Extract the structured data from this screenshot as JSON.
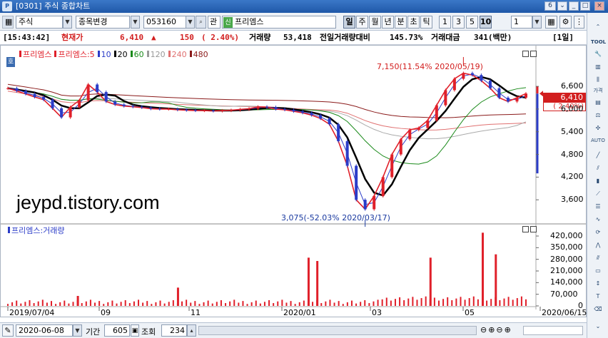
{
  "window": {
    "code": "[0301]",
    "title": "주식 종합차트",
    "counter": "6"
  },
  "toolbar": {
    "market": "주식",
    "change_item": "종목변경",
    "stock_code": "053160",
    "plate_label": "관",
    "stock_badge": "신",
    "stock_name": "프리엠스",
    "periods": [
      "일",
      "주",
      "월",
      "년",
      "분",
      "초",
      "틱"
    ],
    "selected_period": "일",
    "intervals": [
      "1",
      "3",
      "5",
      "10"
    ],
    "selected_interval": "10",
    "count_value": "1"
  },
  "info": {
    "time": "[15:43:42]",
    "label_price": "현재가",
    "price": "6,410",
    "arrow": "▲",
    "change": "150",
    "change_pct": "( 2.40%)",
    "volume_label": "거래량",
    "volume": "53,418",
    "prev_ratio_label": "전일거래량대비",
    "prev_ratio": "145.73%",
    "amount_label": "거래대금",
    "amount": "341(백만)",
    "period_tag": "[1일]"
  },
  "price_panel": {
    "badge": "호",
    "legend": [
      {
        "text": "프리엠스",
        "color": "#e0202a"
      },
      {
        "text": "프리엠스:5",
        "color": "#e0202a"
      },
      {
        "text": "10",
        "color": "#2b3cc8"
      },
      {
        "text": "20",
        "color": "#000000"
      },
      {
        "text": "60",
        "color": "#1a8a1a"
      },
      {
        "text": "120",
        "color": "#999999"
      },
      {
        "text": "240",
        "color": "#e07070"
      },
      {
        "text": "480",
        "color": "#8a1a1a"
      }
    ],
    "annotation_high": "7,150(11.54% 2020/05/19)",
    "annotation_low": "3,075(-52.03% 2020/03/17)",
    "current_price_tag": "6,410",
    "current_pct_tag": "( 2.40%)",
    "y_ticks": [
      "6,600",
      "6,000",
      "5,400",
      "4,800",
      "4,200",
      "3,600"
    ],
    "watermark": "jeypd.tistory.com"
  },
  "volume_panel": {
    "legend": "프리엠스:거래량",
    "y_ticks": [
      "420,000",
      "350,000",
      "280,000",
      "210,000",
      "140,000",
      "70,000",
      "0"
    ]
  },
  "x_axis": {
    "labels": [
      "2019/07/04",
      "09",
      "11",
      "2020/01",
      "03",
      "05",
      "2020/06/15"
    ]
  },
  "bottom": {
    "date": "2020-06-08",
    "period_label": "기간",
    "period_value": "605",
    "view_label": "조회",
    "view_value": "234"
  },
  "sidebar": {
    "items": [
      "TOOL",
      "가격",
      "AUTO"
    ]
  },
  "chart_data": [
    {
      "type": "line",
      "title": "프리엠스",
      "y_ticks": [
        3600,
        4200,
        4800,
        5400,
        6000,
        6600
      ],
      "x_ticks": [
        "2019/07/04",
        "09",
        "11",
        "2020/01",
        "03",
        "05",
        "2020/06/15"
      ],
      "key_points": [
        {
          "date": "2020/03/17",
          "value": 3075,
          "label": "low"
        },
        {
          "date": "2020/05/19",
          "value": 7150,
          "label": "high"
        },
        {
          "date": "2020/06/15",
          "value": 6410,
          "label": "last"
        }
      ],
      "price_path": [
        6550,
        6480,
        6400,
        6320,
        6250,
        6020,
        5780,
        6050,
        6230,
        6650,
        6450,
        6200,
        6120,
        6080,
        6060,
        6040,
        6010,
        6000,
        6000,
        5980,
        5970,
        5960,
        5960,
        5950,
        5960,
        5970,
        5990,
        6010,
        6060,
        6050,
        6000,
        5980,
        5940,
        5900,
        5840,
        5750,
        5600,
        5150,
        4500,
        3600,
        3350,
        3700,
        4200,
        4800,
        5200,
        5450,
        5500,
        5700,
        6100,
        6500,
        6800,
        6950,
        6900,
        6750,
        6550,
        6300,
        6200,
        6300,
        6410
      ]
    },
    {
      "type": "bar",
      "title": "프리엠스:거래량",
      "y_ticks": [
        0,
        70000,
        140000,
        210000,
        280000,
        350000,
        420000
      ],
      "notable_volumes": [
        {
          "period": "2019/08",
          "value": 60000
        },
        {
          "period": "2019/12",
          "value": 110000
        },
        {
          "period": "2020/01",
          "value": 290000
        },
        {
          "period": "2020/01",
          "value": 270000
        },
        {
          "period": "2020/04",
          "value": 290000
        },
        {
          "period": "2020/05",
          "value": 440000
        },
        {
          "period": "2020/05",
          "value": 310000
        }
      ]
    }
  ]
}
